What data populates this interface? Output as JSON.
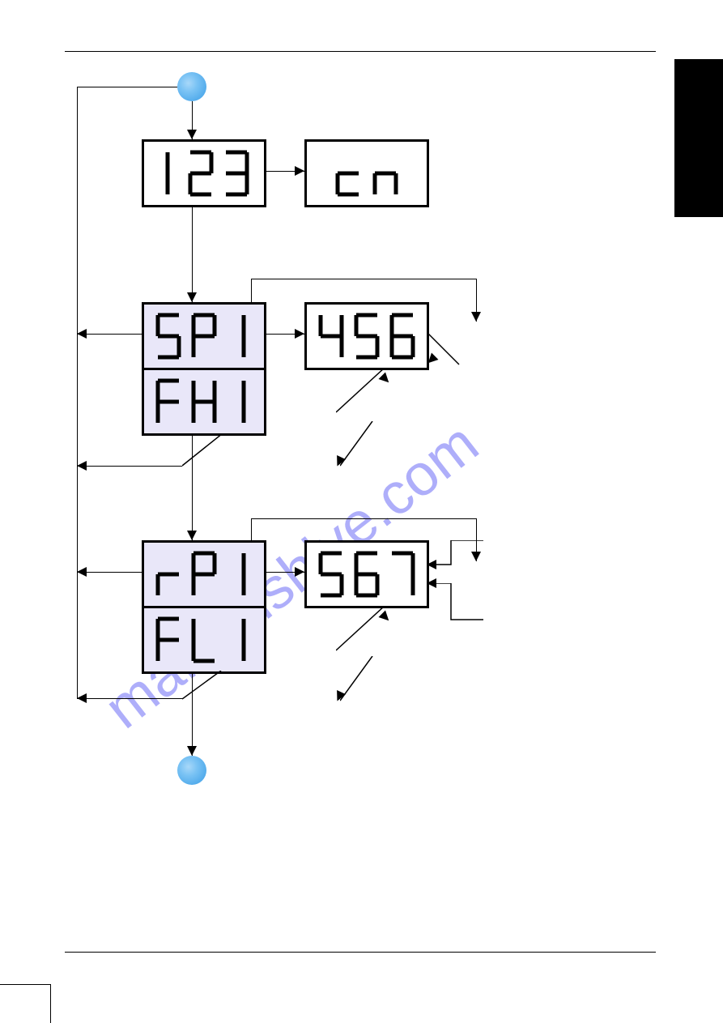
{
  "watermark": "manualshive.com",
  "nodes": {
    "start_circle": {
      "type": "circle"
    },
    "end_circle": {
      "type": "circle"
    },
    "box_123": {
      "type": "lcd",
      "text": "123",
      "bg": "white"
    },
    "box_cn": {
      "type": "lcd",
      "text": "cn",
      "bg": "white"
    },
    "box_SP1": {
      "type": "lcd",
      "text": "SP1",
      "bg": "highlight"
    },
    "box_FH1": {
      "type": "lcd",
      "text": "FH1",
      "bg": "highlight"
    },
    "box_456": {
      "type": "lcd",
      "text": "456",
      "bg": "white"
    },
    "box_rP1": {
      "type": "lcd",
      "text": "rP1",
      "bg": "highlight"
    },
    "box_FL1": {
      "type": "lcd",
      "text": "FL1",
      "bg": "highlight"
    },
    "box_567": {
      "type": "lcd",
      "text": "567",
      "bg": "white"
    }
  },
  "flow": [
    {
      "from": "start_circle",
      "to": "box_123",
      "dir": "down"
    },
    {
      "from": "box_123",
      "to": "box_cn",
      "dir": "right"
    },
    {
      "from": "box_123",
      "to": "box_SP1",
      "dir": "down"
    },
    {
      "from": "box_SP1",
      "to": "box_456",
      "dir": "right"
    },
    {
      "from": "box_SP1",
      "to": "left-bus",
      "dir": "left"
    },
    {
      "from": "box_FH1",
      "to": "left-bus",
      "dir": "left"
    },
    {
      "from": "box_SP1",
      "to": "box_rP1",
      "dir": "down"
    },
    {
      "from": "box_rP1",
      "to": "box_567",
      "dir": "right"
    },
    {
      "from": "box_rP1",
      "to": "left-bus",
      "dir": "left"
    },
    {
      "from": "box_FL1",
      "to": "left-bus",
      "dir": "left"
    },
    {
      "from": "box_rP1",
      "to": "end_circle",
      "dir": "down"
    },
    {
      "from": "left-bus",
      "to": "start_circle",
      "dir": "up"
    }
  ]
}
